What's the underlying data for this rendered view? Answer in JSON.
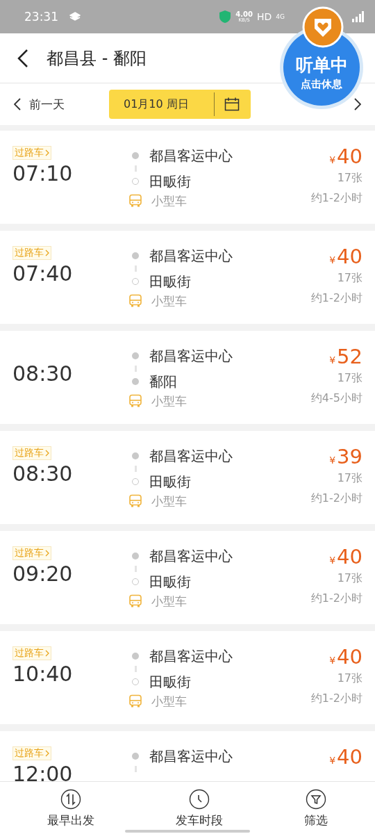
{
  "status_bar": {
    "time": "23:31",
    "speed": "4.00",
    "speed_unit": "KB/S",
    "hd": "HD",
    "network": "4G"
  },
  "header": {
    "title": "都昌县 - 鄱阳"
  },
  "date_bar": {
    "prev": "前一天",
    "date": "01月10 周日"
  },
  "float_bubble": {
    "title": "听单中",
    "subtitle": "点击休息"
  },
  "trips": [
    {
      "tag": "过路车",
      "time": "07:10",
      "origin": "都昌客运中心",
      "destination": "田畈街",
      "dest_terminal": false,
      "vehicle": "小型车",
      "price": "40",
      "seats": "17张",
      "duration": "约1-2小时"
    },
    {
      "tag": "过路车",
      "time": "07:40",
      "origin": "都昌客运中心",
      "destination": "田畈街",
      "dest_terminal": false,
      "vehicle": "小型车",
      "price": "40",
      "seats": "17张",
      "duration": "约1-2小时"
    },
    {
      "time": "08:30",
      "origin": "都昌客运中心",
      "destination": "鄱阳",
      "dest_terminal": true,
      "vehicle": "小型车",
      "price": "52",
      "seats": "17张",
      "duration": "约4-5小时"
    },
    {
      "tag": "过路车",
      "time": "08:30",
      "origin": "都昌客运中心",
      "destination": "田畈街",
      "dest_terminal": false,
      "vehicle": "小型车",
      "price": "39",
      "seats": "17张",
      "duration": "约1-2小时"
    },
    {
      "tag": "过路车",
      "time": "09:20",
      "origin": "都昌客运中心",
      "destination": "田畈街",
      "dest_terminal": false,
      "vehicle": "小型车",
      "price": "40",
      "seats": "17张",
      "duration": "约1-2小时"
    },
    {
      "tag": "过路车",
      "time": "10:40",
      "origin": "都昌客运中心",
      "destination": "田畈街",
      "dest_terminal": false,
      "vehicle": "小型车",
      "price": "40",
      "seats": "17张",
      "duration": "约1-2小时"
    },
    {
      "tag": "过路车",
      "time": "12:00",
      "origin": "都昌客运中心",
      "price": "40"
    }
  ],
  "currency": "¥",
  "bottom_nav": [
    {
      "kind": "sort",
      "label": "最早出发"
    },
    {
      "kind": "clock",
      "label": "发车时段"
    },
    {
      "kind": "filter",
      "label": "筛选"
    }
  ]
}
